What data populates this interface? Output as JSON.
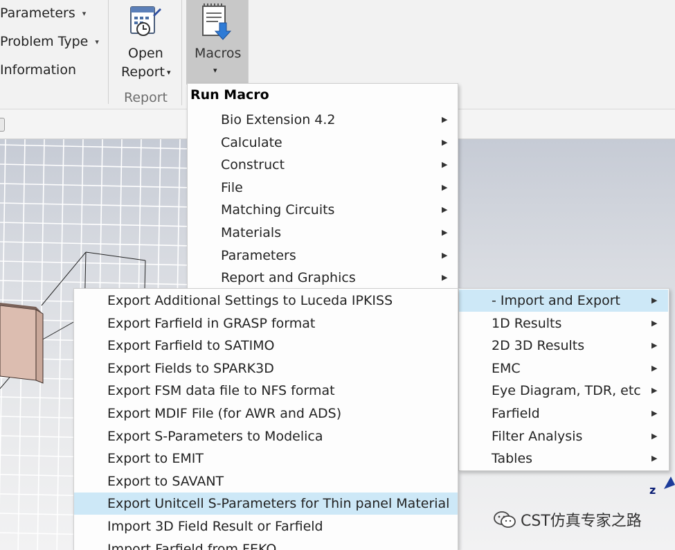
{
  "ribbon": {
    "params_label": "Parameters",
    "problem_type_label": "Problem Type",
    "information_label": "Information",
    "open_report_line1": "Open",
    "open_report_line2": "Report",
    "report_group_label": "Report",
    "macros_label": "Macros",
    "caret_glyph": "▾"
  },
  "run_macro_menu": {
    "header": "Run Macro",
    "items": [
      {
        "label": "Bio Extension 4.2"
      },
      {
        "label": "Calculate"
      },
      {
        "label": "Construct"
      },
      {
        "label": "File"
      },
      {
        "label": "Matching Circuits"
      },
      {
        "label": "Materials"
      },
      {
        "label": "Parameters"
      },
      {
        "label": "Report and Graphics"
      }
    ]
  },
  "results_submenu": {
    "items": [
      {
        "label": "- Import and Export",
        "highlighted": true
      },
      {
        "label": "1D Results"
      },
      {
        "label": "2D 3D Results"
      },
      {
        "label": "EMC"
      },
      {
        "label": "Eye Diagram, TDR, etc"
      },
      {
        "label": "Farfield"
      },
      {
        "label": "Filter Analysis"
      },
      {
        "label": "Tables"
      }
    ]
  },
  "export_submenu": {
    "items": [
      {
        "label": "Export Additional Settings to Luceda IPKISS"
      },
      {
        "label": "Export Farfield in GRASP format"
      },
      {
        "label": "Export Farfield to SATIMO"
      },
      {
        "label": "Export Fields to SPARK3D"
      },
      {
        "label": "Export FSM data file to NFS format"
      },
      {
        "label": "Export MDIF File (for AWR and ADS)"
      },
      {
        "label": "Export S-Parameters to Modelica"
      },
      {
        "label": "Export to EMIT"
      },
      {
        "label": "Export to SAVANT"
      },
      {
        "label": "Export Unitcell S-Parameters for Thin panel Material",
        "highlighted": true
      },
      {
        "label": "Import 3D Field Result or Farfield"
      },
      {
        "label": "Import Farfield from FEKO"
      }
    ]
  },
  "submenu_arrow_glyph": "▶",
  "viewport": {
    "axis_label": "z"
  },
  "watermark": {
    "text": "CST仿真专家之路"
  },
  "colors": {
    "highlight": "#cde8f7",
    "macros_pressed": "#c8c8c8",
    "grid_line": "#ffffff",
    "box_fill": "#dcbdb0"
  }
}
